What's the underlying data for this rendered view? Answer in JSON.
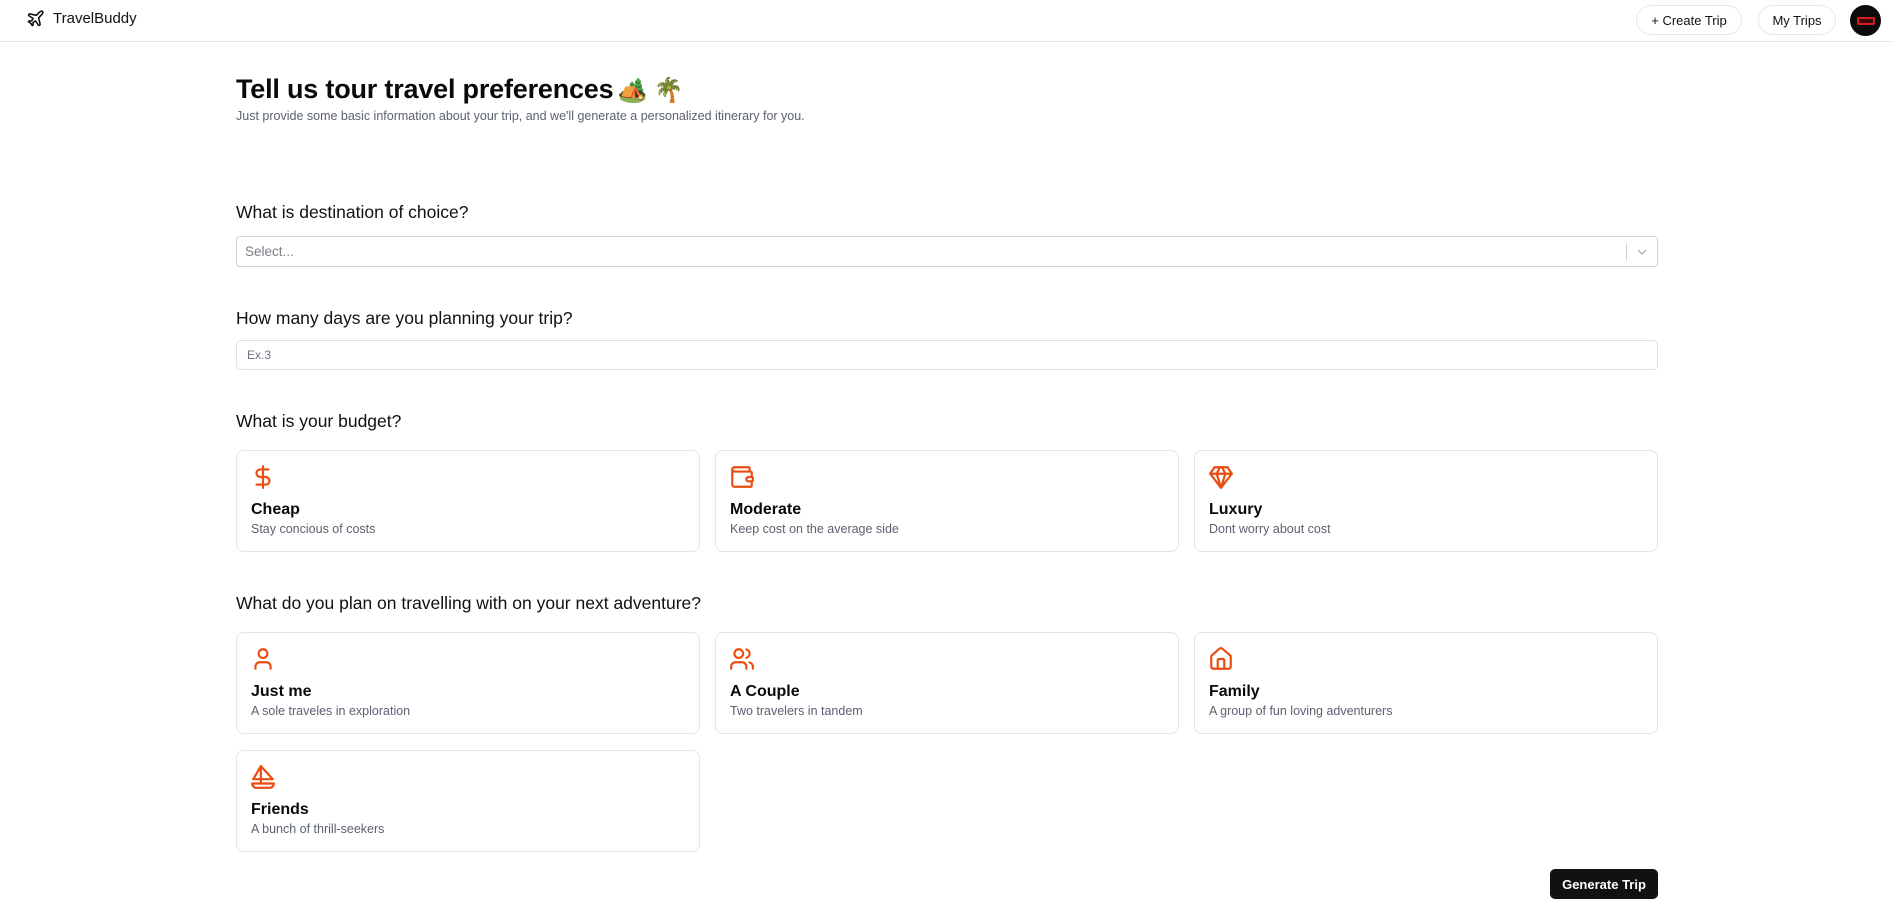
{
  "header": {
    "brand_name": "TravelBuddy",
    "create_trip_label": "+ Create Trip",
    "my_trips_label": "My Trips"
  },
  "hero": {
    "title": "Tell us tour travel preferences",
    "emoji": "🏕️ 🌴",
    "subtitle": "Just provide some basic information about your trip, and we'll generate a personalized itinerary for you."
  },
  "destination": {
    "question": "What is destination of choice?",
    "placeholder": "Select..."
  },
  "days": {
    "question": "How many days are you planning your trip?",
    "placeholder": "Ex.3"
  },
  "budget": {
    "question": "What is your budget?",
    "options": [
      {
        "title": "Cheap",
        "desc": "Stay concious of costs",
        "icon": "dollar-icon"
      },
      {
        "title": "Moderate",
        "desc": "Keep cost on the average side",
        "icon": "wallet-icon"
      },
      {
        "title": "Luxury",
        "desc": "Dont worry about cost",
        "icon": "gem-icon"
      }
    ]
  },
  "travelers": {
    "question": "What do you plan on travelling with on your next adventure?",
    "options": [
      {
        "title": "Just me",
        "desc": "A sole traveles in exploration",
        "icon": "user-icon"
      },
      {
        "title": "A Couple",
        "desc": "Two travelers in tandem",
        "icon": "users-icon"
      },
      {
        "title": "Family",
        "desc": "A group of fun loving adventurers",
        "icon": "home-icon"
      },
      {
        "title": "Friends",
        "desc": "A bunch of thrill-seekers",
        "icon": "sailboat-icon"
      }
    ]
  },
  "actions": {
    "generate_label": "Generate Trip"
  },
  "colors": {
    "accent": "#ea4c11",
    "primary_button": "#111111"
  }
}
